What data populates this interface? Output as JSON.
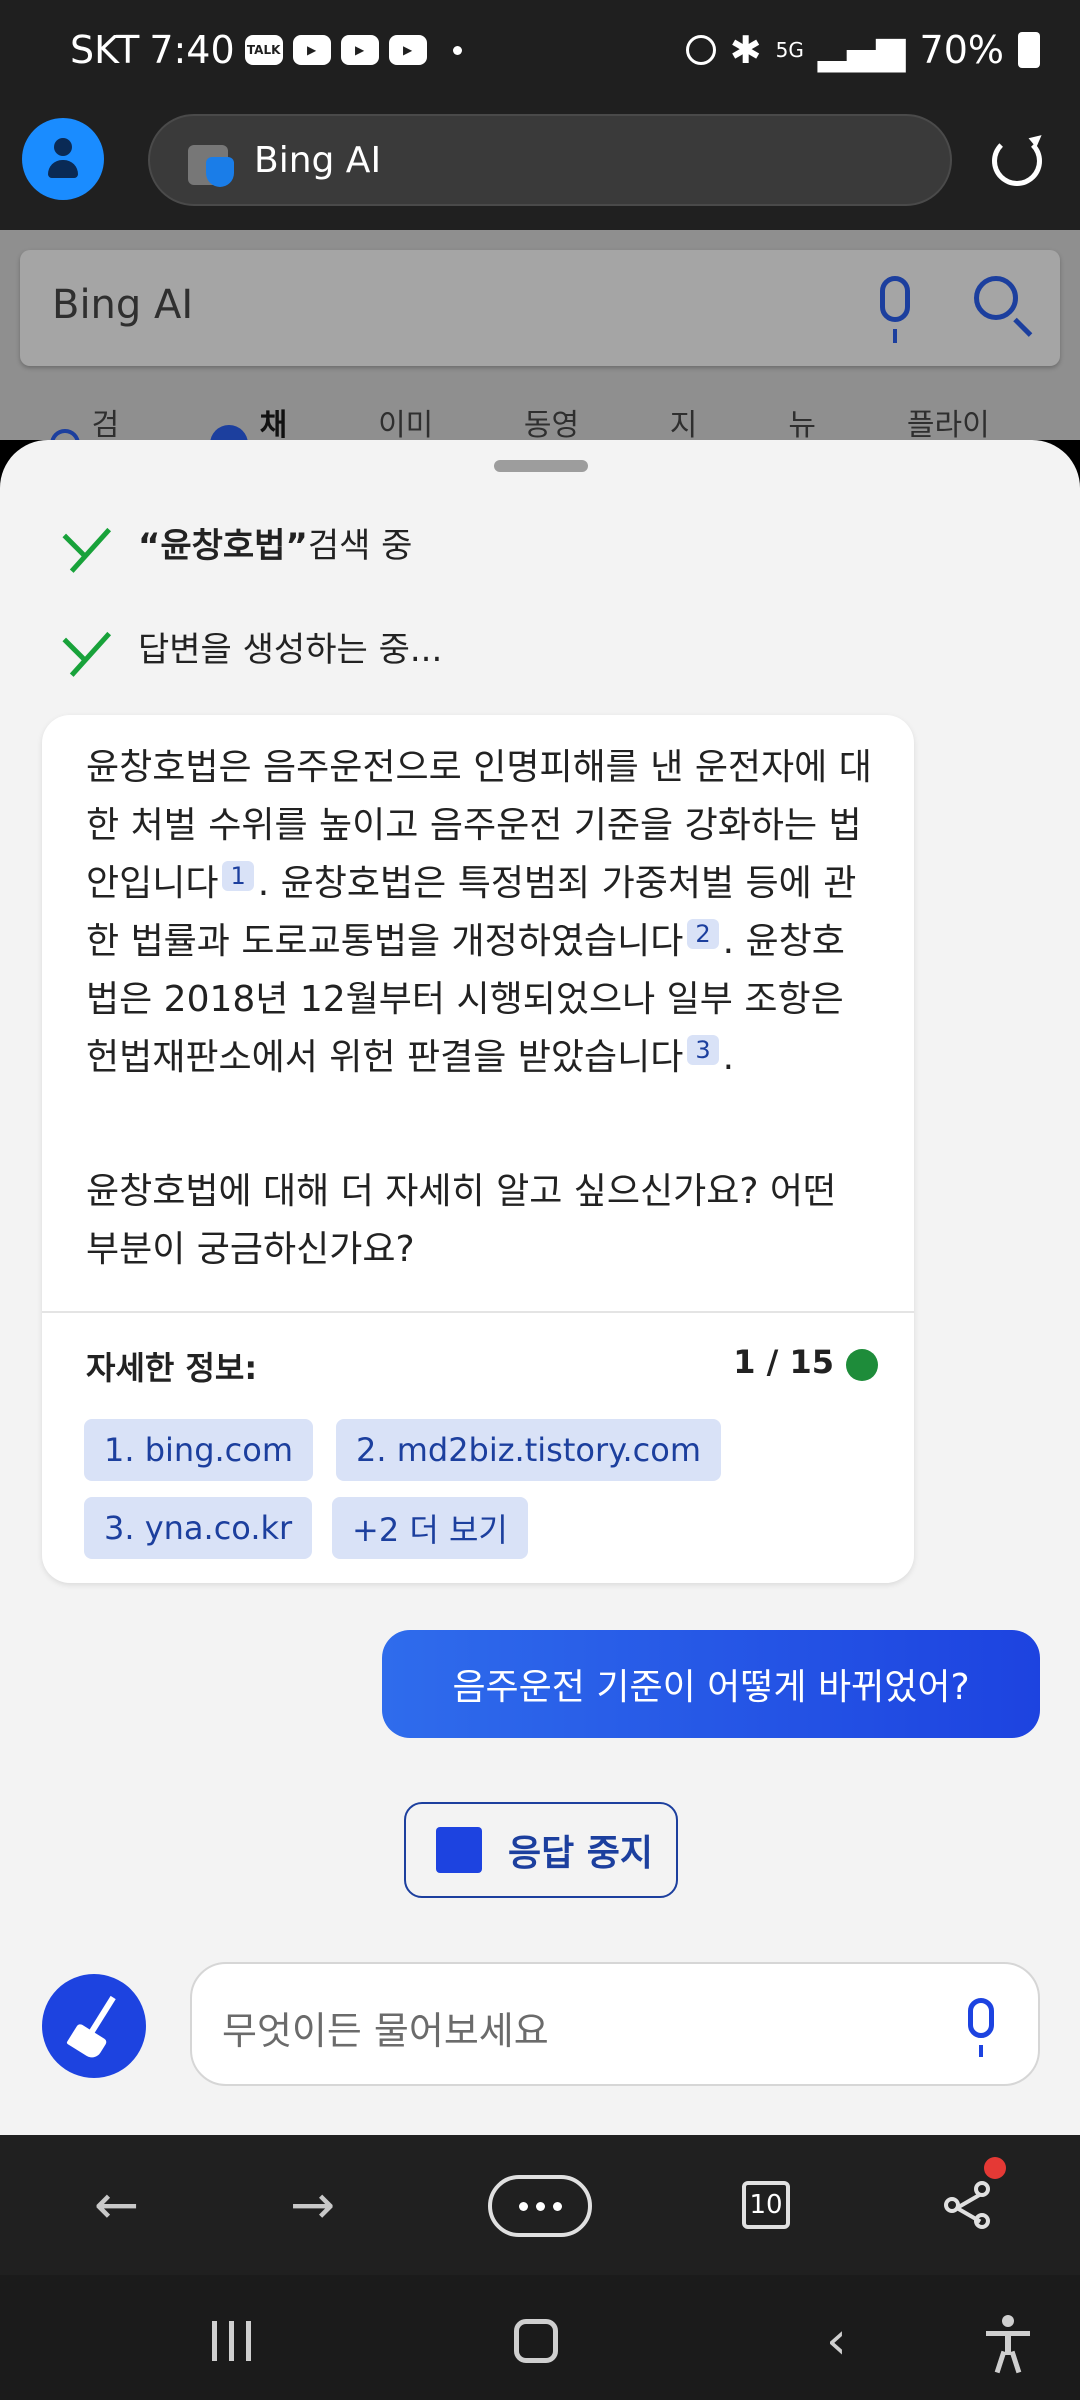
{
  "status_bar": {
    "carrier": "SKT",
    "time": "7:40",
    "notification_icons": [
      "talk-icon",
      "youtube-icon",
      "youtube-icon",
      "youtube-icon"
    ],
    "talk_label": "TALK",
    "network": "5G",
    "battery": "70%"
  },
  "browser": {
    "url_text": "Bing AI",
    "tab_count": "10"
  },
  "page_behind": {
    "query": "Bing AI",
    "tabs": [
      "검색",
      "채팅",
      "이미지",
      "동영상",
      "지도",
      "뉴스",
      "플라이트"
    ],
    "active_tab": "채팅"
  },
  "chat": {
    "step1_quote": "“윤창호법”",
    "step1_suffix": " 검색 중",
    "step2": "답변을 생성하는 중...",
    "answer": {
      "p1a": "윤창호법은 음주운전으로 인명피해를 낸 운전자에 대한 처벌 수위를 높이고 음주운전 기준을 강화하는 법안입니다",
      "c1": "1",
      "p1b": ". 윤창호법은 특정범죄 가중처벌 등에 관한 법률과 도로교통법을 개정하였습니다",
      "c2": "2",
      "p1c": ". 윤창호법은 2018년 12월부터 시행되었으나 일부 조항은 헌법재판소에서 위헌 판결을 받았습니다",
      "c3": "3",
      "p1d": ".",
      "p2": "윤창호법에 대해 더 자세히 알고 싶으신가요? 어떤 부분이 궁금하신가요?"
    },
    "more_info_label": "자세한 정보:",
    "page_count": "1 / 15",
    "sources": [
      "1. bing.com",
      "2. md2biz.tistory.com",
      "3. yna.co.kr",
      "+2 더 보기"
    ],
    "user_message": "음주운전 기준이 어떻게 바뀌었어?",
    "stop_label": "응답 중지",
    "input_placeholder": "무엇이든 물어보세요"
  },
  "colors": {
    "accent": "#1d43e0",
    "check": "#18a23a",
    "status_dot": "#1e8c3a"
  }
}
